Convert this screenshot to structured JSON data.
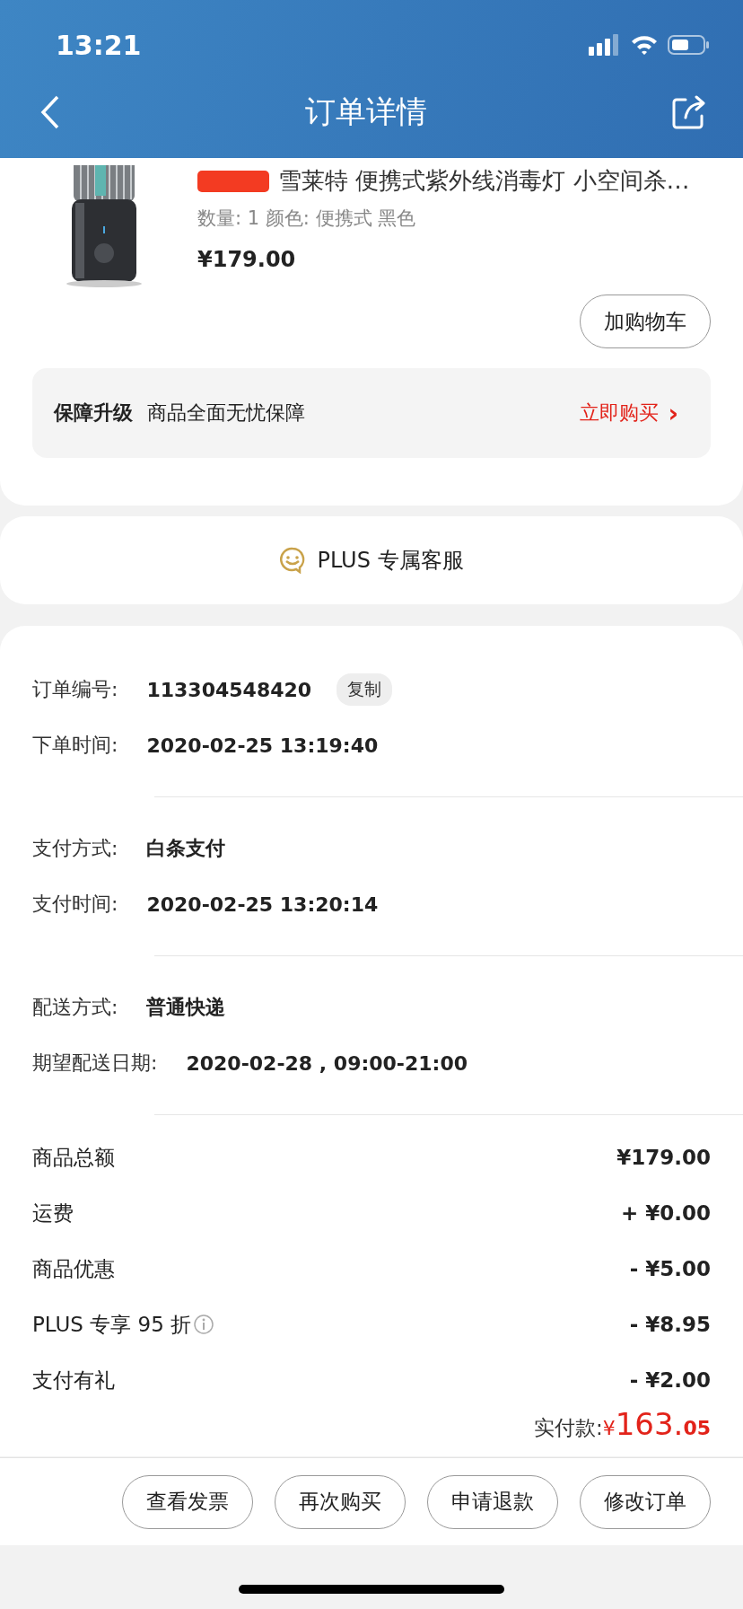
{
  "status_bar": {
    "time": "13:21"
  },
  "nav": {
    "title": "订单详情"
  },
  "product": {
    "title": "雪莱特 便携式紫外线消毒灯 小空间杀…",
    "specs": "数量: 1  颜色: 便携式 黑色",
    "price": "¥179.00",
    "cart_button": "加购物车"
  },
  "protection": {
    "label": "保障升级",
    "text": "商品全面无忧保障",
    "action": "立即购买",
    "chevron": "›"
  },
  "service": {
    "label": "PLUS 专属客服"
  },
  "info_groups": [
    [
      {
        "label": "订单编号:",
        "value": "113304548420",
        "copy": "复制"
      },
      {
        "label": "下单时间:",
        "value": "2020-02-25 13:19:40"
      }
    ],
    [
      {
        "label": "支付方式:",
        "value": "白条支付"
      },
      {
        "label": "支付时间:",
        "value": "2020-02-25 13:20:14"
      }
    ],
    [
      {
        "label": "配送方式:",
        "value": "普通快递"
      },
      {
        "label": "期望配送日期:",
        "value": "2020-02-28 , 09:00-21:00"
      }
    ]
  ],
  "amounts": [
    {
      "label": "商品总额",
      "value": "¥179.00",
      "info": false
    },
    {
      "label": "运费",
      "value": "+ ¥0.00",
      "info": false
    },
    {
      "label": "商品优惠",
      "value": "- ¥5.00",
      "info": false
    },
    {
      "label": "PLUS 专享 95 折",
      "value": "- ¥8.95",
      "info": true
    },
    {
      "label": "支付有礼",
      "value": "- ¥2.00",
      "info": false
    }
  ],
  "total": {
    "label": "实付款:",
    "currency": "¥",
    "integer": "163.",
    "decimals": "05"
  },
  "actions": [
    "查看发票",
    "再次购买",
    "申请退款",
    "修改订单"
  ]
}
